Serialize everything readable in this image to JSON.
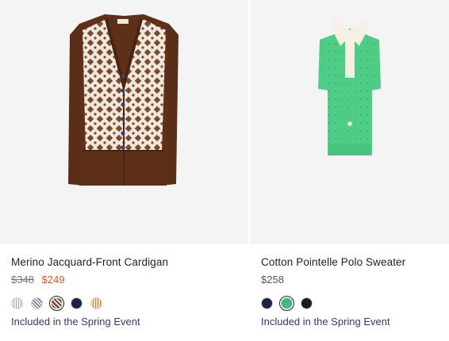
{
  "products": [
    {
      "name": "Merino Jacquard-Front Cardigan",
      "price_original": "$348",
      "price_sale": "$249",
      "event": "Included in the Spring Event",
      "swatches": [
        {
          "color": "#e8eadf",
          "pattern": "stripe-green"
        },
        {
          "color": "#c7c5cc",
          "pattern": "check-navy"
        },
        {
          "color": "#7a5a4a",
          "pattern": "brown",
          "selected": true
        },
        {
          "color": "#1d2346",
          "pattern": "navy"
        },
        {
          "color": "#e8c49a",
          "pattern": "stripe-tan"
        }
      ]
    },
    {
      "name": "Cotton Pointelle Polo Sweater",
      "price": "$258",
      "event": "Included in the Spring Event",
      "swatches": [
        {
          "color": "#1d2346",
          "pattern": "navy"
        },
        {
          "color": "#3ebd7a",
          "pattern": "green",
          "selected": true
        },
        {
          "color": "#1c1c1c",
          "pattern": "black"
        }
      ]
    }
  ]
}
